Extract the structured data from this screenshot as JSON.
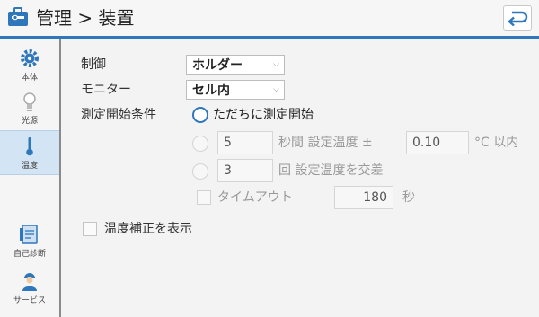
{
  "header": {
    "icon": "settings-case-icon",
    "title": "管理 > 装置",
    "back_icon": "return-arrow-icon"
  },
  "sidebar": {
    "items": [
      {
        "label": "本体",
        "icon": "gear-icon",
        "active": false
      },
      {
        "label": "光源",
        "icon": "lightbulb-icon",
        "active": false
      },
      {
        "label": "温度",
        "icon": "thermometer-icon",
        "active": true
      },
      {
        "label": "自己診断",
        "icon": "self-diagnosis-icon",
        "active": false
      },
      {
        "label": "サービス",
        "icon": "service-person-icon",
        "active": false
      }
    ]
  },
  "form": {
    "control_label": "制御",
    "control_value": "ホルダー",
    "monitor_label": "モニター",
    "monitor_value": "セル内",
    "start_condition_label": "測定開始条件",
    "option_immediate": "ただちに測定開始",
    "seconds_value": "5",
    "seconds_text": "秒間 設定温度 ±",
    "tolerance_value": "0.10",
    "tolerance_unit": "°C 以内",
    "crossings_value": "3",
    "crossings_text": "回 設定温度を交差",
    "timeout_label": "タイムアウト",
    "timeout_value": "180",
    "timeout_unit": "秒",
    "show_correction_label": "温度補正を表示"
  },
  "colors": {
    "accent": "#2e77bb",
    "active_sidebar_bg": "#d3e4f5"
  }
}
